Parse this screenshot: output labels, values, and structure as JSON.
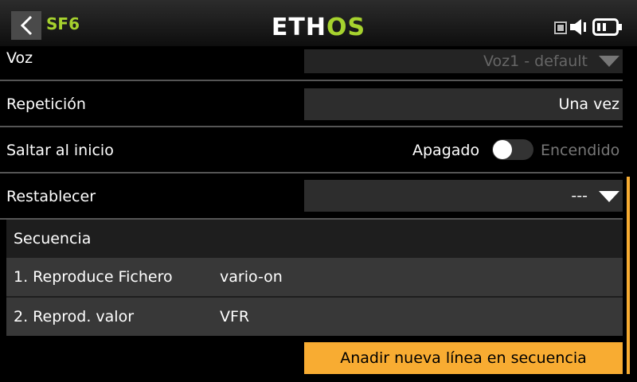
{
  "header": {
    "title": "SF6",
    "logo_text": "ETHOS",
    "logo_colors": {
      "eth": "#ffffff",
      "os": "#a6d22e"
    }
  },
  "fields": {
    "voz": {
      "label": "Voz",
      "value": "Voz1 - default"
    },
    "repeticion": {
      "label": "Repetición",
      "value": "Una vez"
    },
    "saltar": {
      "label": "Saltar al inicio",
      "off_label": "Apagado",
      "on_label": "Encendido",
      "state": "off"
    },
    "restablecer": {
      "label": "Restablecer",
      "value": "---"
    }
  },
  "sequence": {
    "header": "Secuencia",
    "items": [
      {
        "name": "1. Reproduce Fichero",
        "value": "vario-on"
      },
      {
        "name": "2. Reprod. valor",
        "value": "VFR"
      }
    ],
    "add_label": "Anadir nueva línea en secuencia"
  },
  "colors": {
    "accent": "#f8ac32",
    "brand_green": "#a6d22e"
  }
}
